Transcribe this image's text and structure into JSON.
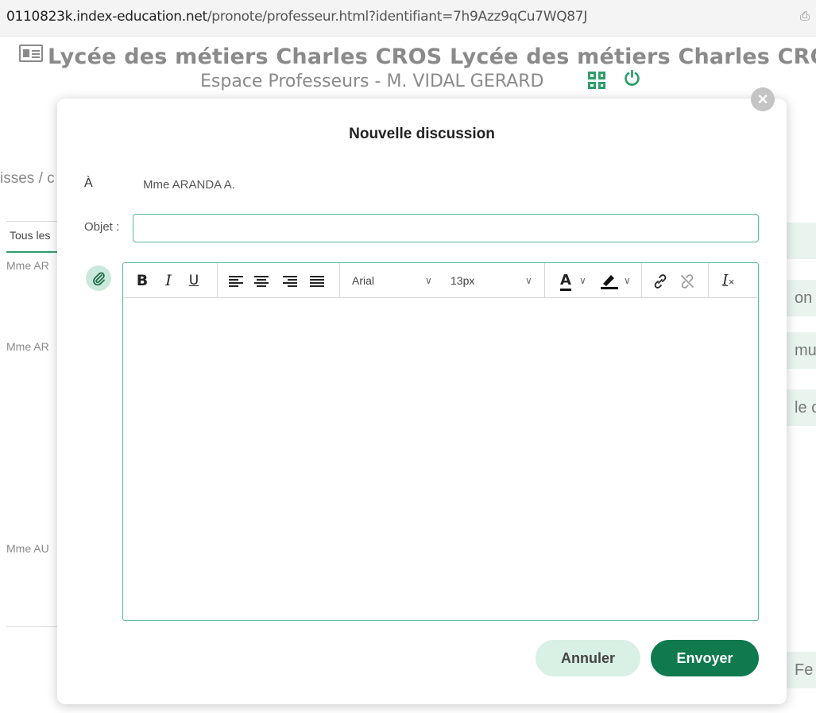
{
  "browser": {
    "url_host": "0110823k.index-education.net",
    "url_path": "/pronote/professeur.html?identifiant=7h9Azz9qCu7WQ87J"
  },
  "header": {
    "school_name": "Lycée des métiers Charles CROS Lycée des métiers Charles CRO",
    "space_label": "Espace Professeurs - M. VIDAL GERARD"
  },
  "background": {
    "breadcrumb": "isses / c",
    "filter_tab": "Tous les",
    "list_items": [
      "Mme AR",
      "Mme AR",
      "Mme AU"
    ],
    "right_pills": [
      "on",
      "mu",
      "le c",
      "Fe"
    ]
  },
  "modal": {
    "title": "Nouvelle discussion",
    "to_label": "À",
    "recipient": "Mme ARANDA A.",
    "subject_label": "Objet :",
    "subject_value": "",
    "toolbar": {
      "bold": "B",
      "italic": "I",
      "underline": "U",
      "font_family": "Arial",
      "font_size": "13px",
      "text_color_label": "A",
      "clear_format_label": "I"
    },
    "cancel_label": "Annuler",
    "send_label": "Envoyer"
  },
  "colors": {
    "accent": "#58b894",
    "primary_button": "#0e7a4e",
    "secondary_button": "#d9f0e5",
    "header_grey": "#8a8a8a"
  }
}
